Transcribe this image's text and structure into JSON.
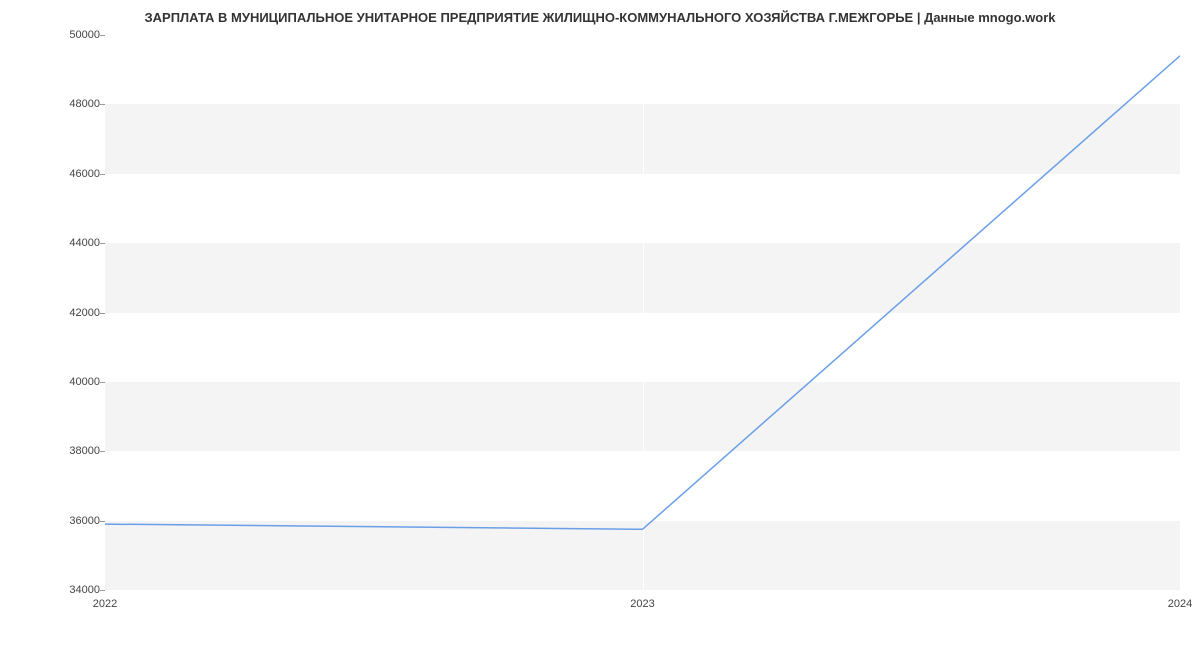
{
  "chart_data": {
    "type": "line",
    "title": "ЗАРПЛАТА В МУНИЦИПАЛЬНОЕ УНИТАРНОЕ ПРЕДПРИЯТИЕ ЖИЛИЩНО-КОММУНАЛЬНОГО ХОЗЯЙСТВА Г.МЕЖГОРЬЕ | Данные mnogo.work",
    "categories": [
      "2022",
      "2023",
      "2024"
    ],
    "x": [
      2022,
      2023,
      2024
    ],
    "values": [
      35900,
      35750,
      49400
    ],
    "xlabel": "",
    "ylabel": "",
    "ylim": [
      34000,
      50000
    ],
    "y_ticks": [
      34000,
      36000,
      38000,
      40000,
      42000,
      44000,
      46000,
      48000,
      50000
    ],
    "grid": true,
    "line_color": "#6a9fe8"
  }
}
